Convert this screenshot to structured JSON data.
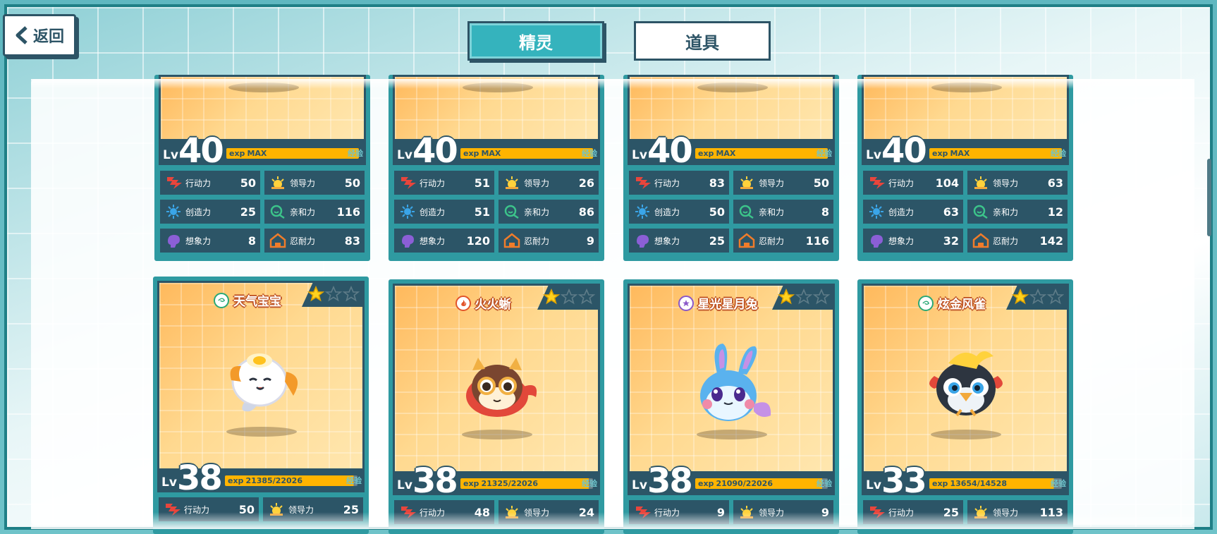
{
  "nav": {
    "back_label": "返回",
    "tabs": [
      {
        "label": "精灵",
        "active": true
      },
      {
        "label": "道具",
        "active": false
      }
    ]
  },
  "colors": {
    "teal": "#35b3bd",
    "navy": "#2c5567",
    "exp_bar": "#ffb400",
    "card_bg": "#ffd58a"
  },
  "stat_labels": {
    "action": "行动力",
    "lead": "领导力",
    "create": "创造力",
    "affinity": "亲和力",
    "imagine": "想象力",
    "endure": "忍耐力"
  },
  "row1": [
    {
      "level": "40",
      "exp_prefix": "exp",
      "exp_text": "MAX",
      "exp_fraction": 1.0,
      "exp_tag": "经验",
      "stats": {
        "action": "50",
        "lead": "50",
        "create": "25",
        "affinity": "116",
        "imagine": "8",
        "endure": "83"
      }
    },
    {
      "level": "40",
      "exp_prefix": "exp",
      "exp_text": "MAX",
      "exp_fraction": 1.0,
      "exp_tag": "经验",
      "stats": {
        "action": "51",
        "lead": "26",
        "create": "51",
        "affinity": "86",
        "imagine": "120",
        "endure": "9"
      }
    },
    {
      "level": "40",
      "exp_prefix": "exp",
      "exp_text": "MAX",
      "exp_fraction": 1.0,
      "exp_tag": "经验",
      "stats": {
        "action": "83",
        "lead": "50",
        "create": "50",
        "affinity": "8",
        "imagine": "25",
        "endure": "116"
      }
    },
    {
      "level": "40",
      "exp_prefix": "exp",
      "exp_text": "MAX",
      "exp_fraction": 1.0,
      "exp_tag": "经验",
      "stats": {
        "action": "104",
        "lead": "63",
        "create": "63",
        "affinity": "12",
        "imagine": "32",
        "endure": "142"
      }
    }
  ],
  "row2": [
    {
      "name": "天气宝宝",
      "element": "wind-element-icon",
      "element_color": "#2aa876",
      "stars": 1,
      "stars_max": 3,
      "level": "38",
      "exp_prefix": "exp",
      "exp_text": "21385/22026",
      "exp_fraction": 0.971,
      "exp_tag": "经验",
      "creature": "weather-baby",
      "stats": {
        "action": "50",
        "lead": "25"
      }
    },
    {
      "name": "火火蜥",
      "element": "fire-element-icon",
      "element_color": "#e2542a",
      "stars": 1,
      "stars_max": 3,
      "level": "38",
      "exp_prefix": "exp",
      "exp_text": "21325/22026",
      "exp_fraction": 0.968,
      "exp_tag": "经验",
      "creature": "fire-lizard",
      "stats": {
        "action": "48",
        "lead": "24"
      }
    },
    {
      "name": "星光星月兔",
      "element": "star-element-icon",
      "element_color": "#8a58c8",
      "stars": 1,
      "stars_max": 3,
      "level": "38",
      "exp_prefix": "exp",
      "exp_text": "21090/22026",
      "exp_fraction": 0.957,
      "exp_tag": "经验",
      "creature": "star-rabbit",
      "stats": {
        "action": "9",
        "lead": "9"
      }
    },
    {
      "name": "炫金风雀",
      "element": "wind-element-icon",
      "element_color": "#2aa876",
      "stars": 1,
      "stars_max": 3,
      "level": "33",
      "exp_prefix": "exp",
      "exp_text": "13654/14528",
      "exp_fraction": 0.94,
      "exp_tag": "经验",
      "creature": "gold-finch",
      "stats": {
        "action": "25",
        "lead": "113"
      }
    }
  ]
}
